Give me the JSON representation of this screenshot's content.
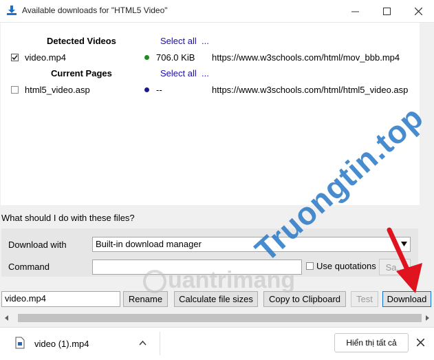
{
  "window": {
    "title": "Available downloads for \"HTML5 Video\"",
    "minimize": "—",
    "maximize": "☐",
    "close": "✕"
  },
  "list": {
    "sections": [
      {
        "header": "Detected Videos",
        "select_all": "Select all",
        "more": "...",
        "rows": [
          {
            "checked": true,
            "name": "video.mp4",
            "status_color": "#1e8c1e",
            "size": "706.0 KiB",
            "url": "https://www.w3schools.com/html/mov_bbb.mp4"
          }
        ]
      },
      {
        "header": "Current Pages",
        "select_all": "Select all",
        "more": "...",
        "rows": [
          {
            "checked": false,
            "name": "html5_video.asp",
            "status_color": "#1a1a8c",
            "size": "--",
            "url": "https://www.w3schools.com/html/html5_video.asp"
          }
        ]
      }
    ]
  },
  "options": {
    "question": "What should I do with these files?",
    "download_with_label": "Download with",
    "download_with_value": "Built-in download manager",
    "command_label": "Command",
    "command_value": "",
    "use_quotations_label": "Use quotations",
    "save_button": "Sa..."
  },
  "actions": {
    "filename_value": "video.mp4",
    "rename": "Rename",
    "calculate": "Calculate file sizes",
    "copy": "Copy to Clipboard",
    "test": "Test",
    "download": "Download"
  },
  "download_bar": {
    "item_name": "video (1).mp4",
    "show_all": "Hiển thị tất cả"
  },
  "watermark": {
    "site_text": "uantrimang",
    "brand_text": "Truongtin.top"
  }
}
